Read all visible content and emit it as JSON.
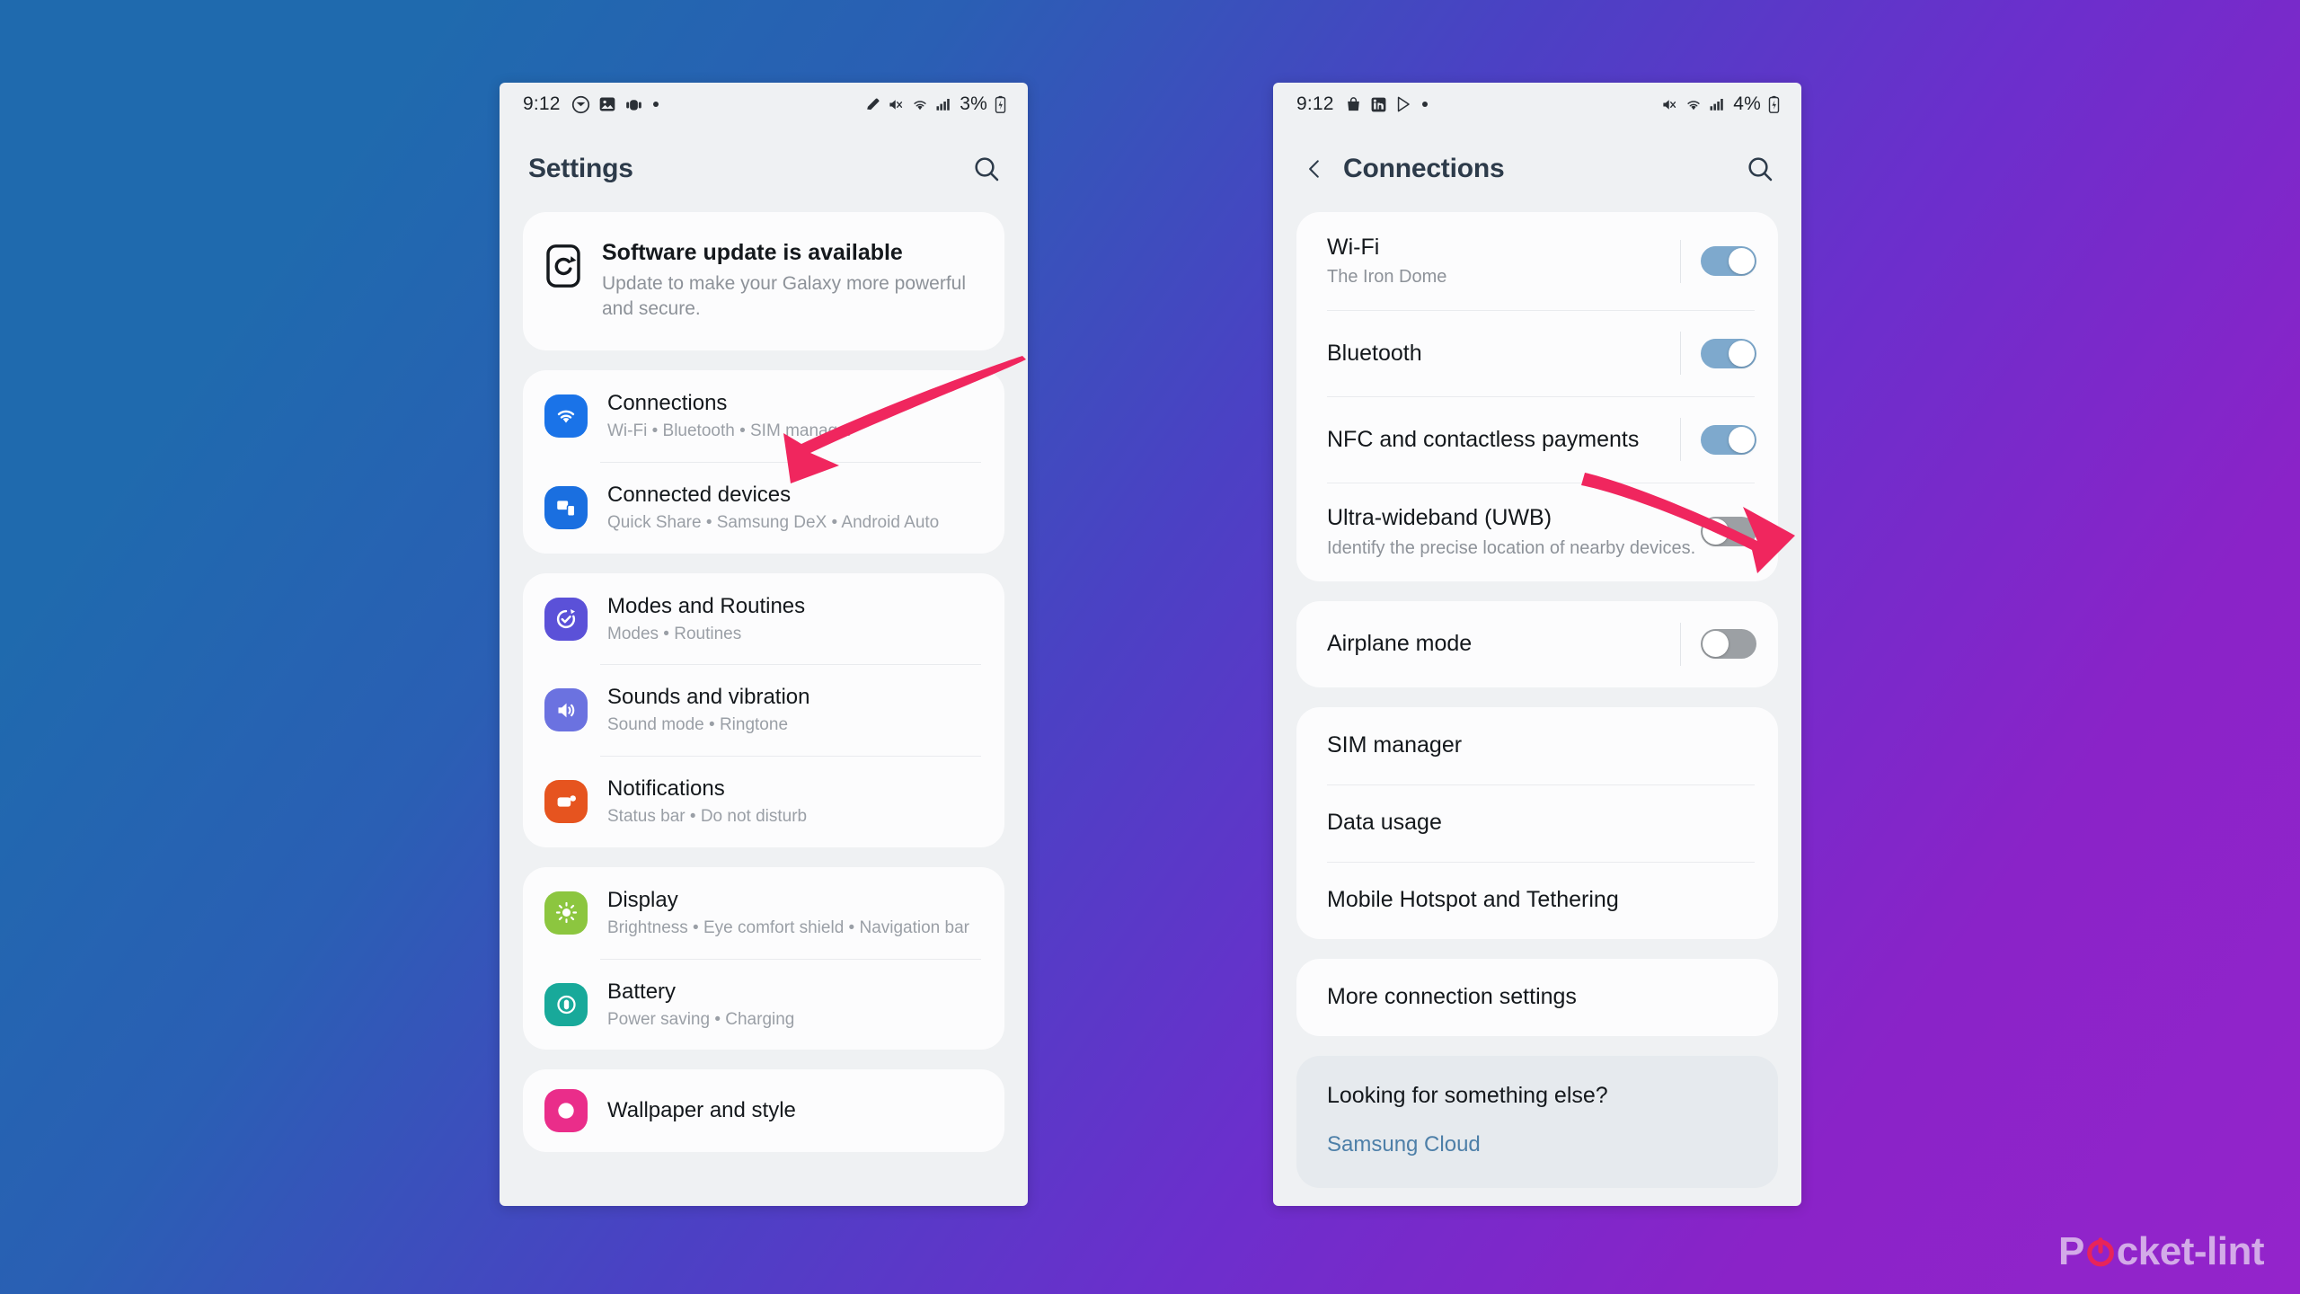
{
  "background": {
    "from": "#1f6aae",
    "to": "#9424cb"
  },
  "accent": {
    "arrow": "#f0265e",
    "toggle_on": "#7ea9cd",
    "toggle_off": "#9ca0a4",
    "link": "#4d7fa8"
  },
  "watermark": {
    "text_before": "P",
    "text_after": "cket-lint",
    "icon": "power-icon",
    "color": "#d3aae8",
    "icon_color": "#e8245a"
  },
  "left_phone": {
    "statusbar": {
      "clock": "9:12",
      "left_icons": [
        "mail-circle-icon",
        "photo-icon",
        "android-icon",
        "more-dot-icon"
      ],
      "right_icons": [
        "pencil-icon",
        "mute-icon",
        "wifi-icon",
        "signal-icon"
      ],
      "battery_percent": "3%",
      "battery_icon": "battery-charging-icon"
    },
    "header": {
      "title": "Settings",
      "search_icon": "search-icon"
    },
    "update_banner": {
      "icon": "software-update-icon",
      "title": "Software update is available",
      "subtitle": "Update to make your Galaxy more powerful and secure."
    },
    "groups": [
      {
        "items": [
          {
            "title": "Connections",
            "subtitle": "Wi-Fi • Bluetooth • SIM manager",
            "icon": "wifi-icon",
            "icon_color": "#1a73e8"
          },
          {
            "title": "Connected devices",
            "subtitle": "Quick Share • Samsung DeX • Android Auto",
            "icon": "connected-devices-icon",
            "icon_color": "#1a6fe0"
          }
        ]
      },
      {
        "items": [
          {
            "title": "Modes and Routines",
            "subtitle": "Modes • Routines",
            "icon": "modes-routines-icon",
            "icon_color": "#5b51d8"
          },
          {
            "title": "Sounds and vibration",
            "subtitle": "Sound mode • Ringtone",
            "icon": "sound-icon",
            "icon_color": "#6b72e0"
          },
          {
            "title": "Notifications",
            "subtitle": "Status bar • Do not disturb",
            "icon": "notifications-icon",
            "icon_color": "#e6541f"
          }
        ]
      },
      {
        "items": [
          {
            "title": "Display",
            "subtitle": "Brightness • Eye comfort shield • Navigation bar",
            "icon": "display-icon",
            "icon_color": "#8cc63f"
          },
          {
            "title": "Battery",
            "subtitle": "Power saving • Charging",
            "icon": "battery-icon",
            "icon_color": "#18a99a"
          }
        ]
      },
      {
        "items": [
          {
            "title": "Wallpaper and style",
            "subtitle": "",
            "icon": "wallpaper-icon",
            "icon_color": "#ea2d8a"
          }
        ]
      }
    ]
  },
  "right_phone": {
    "statusbar": {
      "clock": "9:12",
      "left_icons": [
        "shopping-bag-icon",
        "linkedin-icon",
        "play-store-icon",
        "more-dot-icon"
      ],
      "right_icons": [
        "mute-icon",
        "wifi-icon",
        "signal-icon"
      ],
      "battery_percent": "4%",
      "battery_icon": "battery-charging-icon"
    },
    "header": {
      "back_icon": "chevron-left-icon",
      "title": "Connections",
      "search_icon": "search-icon"
    },
    "toggle_group": [
      {
        "title": "Wi-Fi",
        "subtitle": "The Iron Dome",
        "state": "on",
        "divider": true
      },
      {
        "title": "Bluetooth",
        "subtitle": "",
        "state": "on",
        "divider": true
      },
      {
        "title": "NFC and contactless payments",
        "subtitle": "",
        "state": "on",
        "divider": true
      },
      {
        "title": "Ultra-wideband (UWB)",
        "subtitle": "Identify the precise location of nearby devices.",
        "state": "off",
        "divider": false
      }
    ],
    "airplane_group": [
      {
        "title": "Airplane mode",
        "subtitle": "",
        "state": "off",
        "divider": true
      }
    ],
    "list_group": [
      {
        "title": "SIM manager"
      },
      {
        "title": "Data usage"
      },
      {
        "title": "Mobile Hotspot and Tethering"
      }
    ],
    "more_group": [
      {
        "title": "More connection settings"
      }
    ],
    "footer": {
      "question": "Looking for something else?",
      "link": "Samsung Cloud"
    }
  }
}
